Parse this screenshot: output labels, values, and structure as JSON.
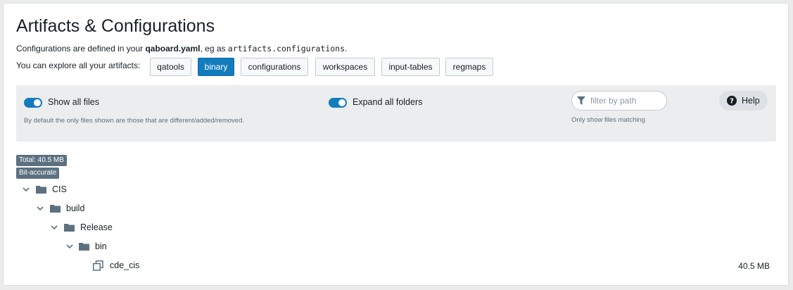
{
  "header": {
    "title": "Artifacts & Configurations",
    "desc_prefix": "Configurations are defined in your ",
    "desc_file": "qaboard.yaml",
    "desc_mid": ", eg as ",
    "desc_code": "artifacts.configurations",
    "desc_suffix": "."
  },
  "explore": {
    "label": "You can explore all your artifacts:",
    "buttons": [
      "qatools",
      "binary",
      "configurations",
      "workspaces",
      "input-tables",
      "regmaps"
    ],
    "active": "binary"
  },
  "options": {
    "show_all_files": {
      "label": "Show all files",
      "on": true
    },
    "show_all_hint": "By default the only files shown are those that are different/added/removed.",
    "expand_all_folders": {
      "label": "Expand all folders",
      "on": true
    },
    "filter": {
      "placeholder": "filter by path",
      "value": "",
      "hint": "Only show files matching"
    },
    "help_label": "Help"
  },
  "tags": [
    "Total: 40.5 MB",
    "Bit-accurate"
  ],
  "tree": [
    {
      "label": "CIS",
      "type": "folder",
      "depth": 0
    },
    {
      "label": "build",
      "type": "folder",
      "depth": 1
    },
    {
      "label": "Release",
      "type": "folder",
      "depth": 2
    },
    {
      "label": "bin",
      "type": "folder",
      "depth": 3
    },
    {
      "label": "cde_cis",
      "type": "file",
      "depth": 4,
      "size": "40.5 MB"
    }
  ],
  "colors": {
    "accent": "#137cbd",
    "tag": "#5c7080",
    "panel": "#ebedef"
  },
  "icons": [
    "chevron-down-icon",
    "folder-icon",
    "file-duplicate-icon",
    "filter-icon",
    "help-icon"
  ]
}
